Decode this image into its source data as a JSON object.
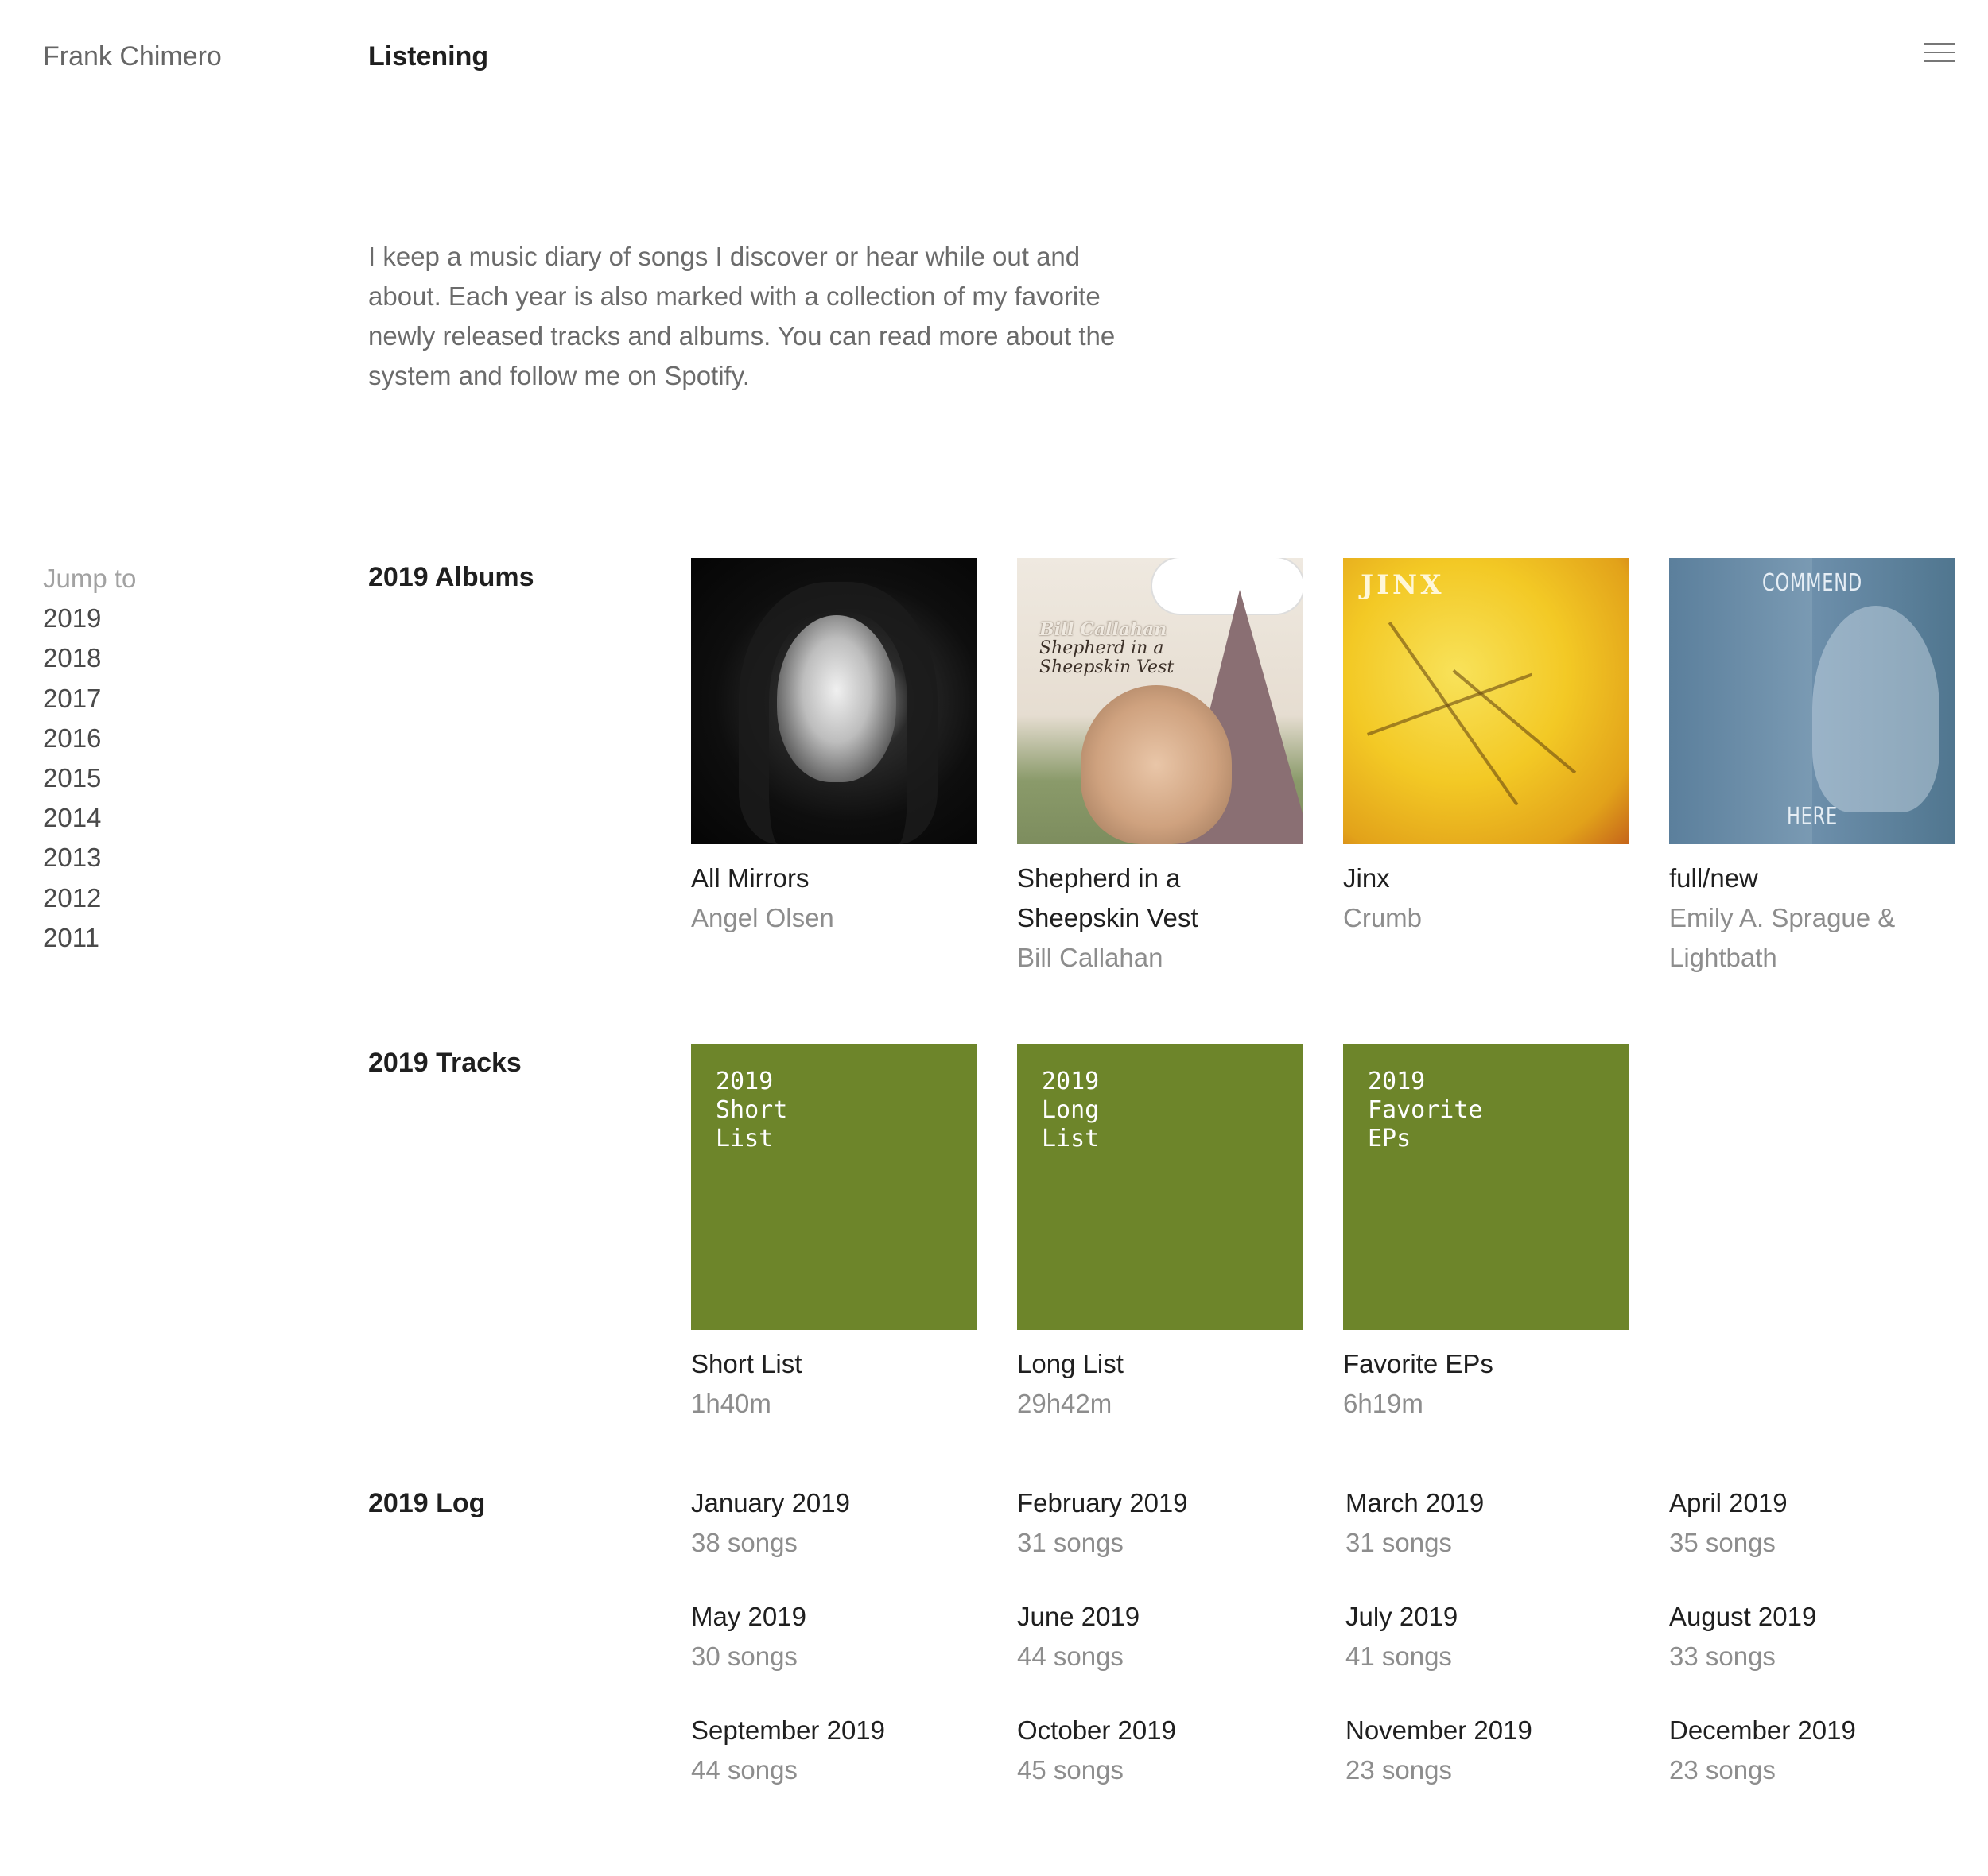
{
  "header": {
    "site_name": "Frank Chimero",
    "page_title": "Listening"
  },
  "intro": {
    "text": "I keep a music diary of songs I discover or hear while out and about. Each year is also marked with a collection of my favorite newly released tracks and albums. You can read more about the system and follow me on Spotify."
  },
  "jump": {
    "label": "Jump to",
    "years": [
      "2019",
      "2018",
      "2017",
      "2016",
      "2015",
      "2014",
      "2013",
      "2012",
      "2011"
    ]
  },
  "albums": {
    "label": "2019 Albums",
    "items": [
      {
        "title": "All Mirrors",
        "artist": "Angel Olsen"
      },
      {
        "title": "Shepherd in a Sheepskin Vest",
        "artist": "Bill Callahan",
        "art_text": [
          "Bill Callahan",
          "Shepherd in a",
          "Sheepskin Vest"
        ]
      },
      {
        "title": "Jinx",
        "artist": "Crumb",
        "art_text": "JINX"
      },
      {
        "title": "full/new",
        "artist": "Emily A. Sprague & Lightbath",
        "art_text_top": "COMMEND",
        "art_text_bottom": "HERE"
      }
    ]
  },
  "tracks": {
    "label": "2019 Tracks",
    "items": [
      {
        "cover": "2019\nShort\nList",
        "title": "Short List",
        "duration": "1h40m"
      },
      {
        "cover": "2019\nLong\nList",
        "title": "Long List",
        "duration": "29h42m"
      },
      {
        "cover": "2019\nFavorite\nEPs",
        "title": "Favorite EPs",
        "duration": "6h19m"
      }
    ]
  },
  "log": {
    "label": "2019 Log",
    "items": [
      {
        "month": "January 2019",
        "count": "38 songs"
      },
      {
        "month": "February 2019",
        "count": "31 songs"
      },
      {
        "month": "March 2019",
        "count": "31 songs"
      },
      {
        "month": "April 2019",
        "count": "35 songs"
      },
      {
        "month": "May 2019",
        "count": "30 songs"
      },
      {
        "month": "June 2019",
        "count": "44 songs"
      },
      {
        "month": "July 2019",
        "count": "41 songs"
      },
      {
        "month": "August 2019",
        "count": "33 songs"
      },
      {
        "month": "September 2019",
        "count": "44 songs"
      },
      {
        "month": "October 2019",
        "count": "45 songs"
      },
      {
        "month": "November 2019",
        "count": "23 songs"
      },
      {
        "month": "December 2019",
        "count": "23 songs"
      }
    ]
  },
  "colors": {
    "track_cover": "#6d852a",
    "text_primary": "#1f1f1f",
    "text_secondary": "#8d8d8d"
  }
}
